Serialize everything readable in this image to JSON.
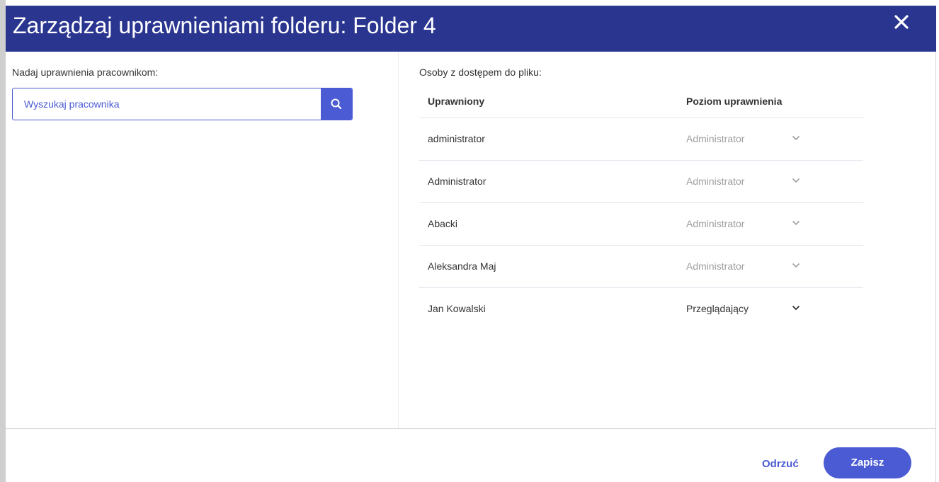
{
  "dialog": {
    "title": "Zarządzaj uprawnieniami folderu: Folder 4",
    "close_icon": "close-icon"
  },
  "left_panel": {
    "label": "Nadaj uprawnienia pracownikom:",
    "search": {
      "placeholder": "Wyszukaj pracownika",
      "value": "",
      "icon": "search-icon"
    }
  },
  "right_panel": {
    "label": "Osoby z dostępem do pliku:",
    "columns": {
      "user": "Uprawniony",
      "level": "Poziom uprawnienia"
    },
    "rows": [
      {
        "name": "administrator",
        "level": "Administrator",
        "enabled": false
      },
      {
        "name": "Administrator",
        "level": "Administrator",
        "enabled": false
      },
      {
        "name": "Abacki",
        "level": "Administrator",
        "enabled": false
      },
      {
        "name": "Aleksandra Maj",
        "level": "Administrator",
        "enabled": false
      },
      {
        "name": "Jan Kowalski",
        "level": "Przeglądający",
        "enabled": true
      }
    ]
  },
  "footer": {
    "discard_label": "Odrzuć",
    "save_label": "Zapisz"
  },
  "colors": {
    "header_bg": "#2a3590",
    "accent": "#4a5bd4",
    "disabled_text": "#9e9e9e"
  }
}
